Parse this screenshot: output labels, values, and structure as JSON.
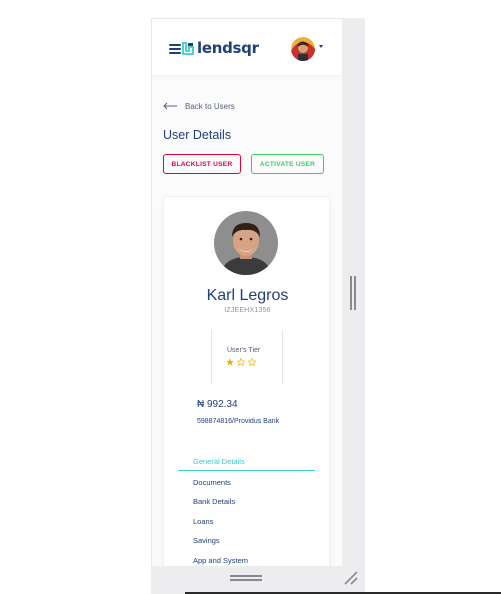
{
  "app": {
    "brand_name": "lendsqr",
    "brand_color": "#213f7d"
  },
  "navbar": {
    "menu_icon": "hamburger-menu-icon",
    "avatar_alt": "user avatar",
    "dropdown_icon": "caret-down-icon"
  },
  "page": {
    "back_link_label": "Back to Users",
    "title": "User Details",
    "actions": {
      "blacklist_label": "BLACKLIST USER",
      "activate_label": "ACTIVATE USER"
    }
  },
  "profile": {
    "name": "Karl Legros",
    "user_code": "IZJEEHX1356",
    "tier_label": "User's Tier",
    "tier_stars_filled": 1,
    "tier_stars_total": 3,
    "balance": "₦ 992.34",
    "bank_account": "598874816/Providus Bank"
  },
  "tabs": [
    {
      "label": "General Details",
      "active": true
    },
    {
      "label": "Documents",
      "active": false
    },
    {
      "label": "Bank Details",
      "active": false
    },
    {
      "label": "Loans",
      "active": false
    },
    {
      "label": "Savings",
      "active": false
    },
    {
      "label": "App and System",
      "active": false
    }
  ],
  "colors": {
    "primary_text": "#213f7d",
    "secondary_text": "#545f7d",
    "accent_teal": "#39cdcc",
    "danger": "#e4033b",
    "success": "#39cd62",
    "star": "#e9b200"
  }
}
